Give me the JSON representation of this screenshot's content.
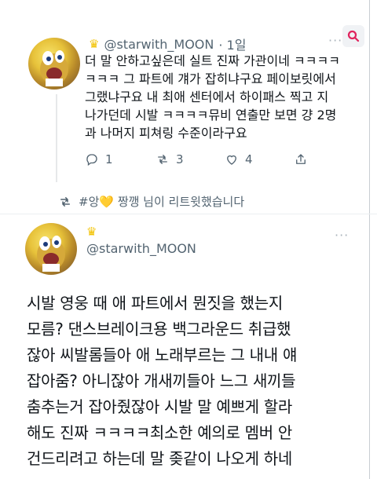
{
  "tweet1": {
    "handle": "@starwith_MOON",
    "time": "· 1일",
    "crown_icon": "crown",
    "text": "더 말 안하고싶은데 실트 진짜 가관이네 ㅋㅋㅋㅋ\nㅋㅋㅋ 그 파트에 걔가 잡히냐구요 페이보릿에서\n그랬냐구요  내 최애 센터에서 하이패스 찍고 지\n나가던데 시발 ㅋㅋㅋㅋ뮤비 연출만 보면 걍 2명\n과 나머지 피쳐링 수준이라구요",
    "reply_count": "1",
    "retweet_count": "3",
    "like_count": "4"
  },
  "retweet_banner": {
    "text": "#앙💛 짱깽 님이 리트윗했습니다"
  },
  "tweet2": {
    "handle": "@starwith_MOON",
    "crown_icon": "crown",
    "text": "시발 영웅 때 애 파트에서 뭔짓을 했는지\n모름? 댄스브레이크용 백그라운드 취급했\n잖아 씨발롬들아 애 노래부르는 그 내내 얘\n잡아줌? 아니잖아 개새끼들아 느그 새끼들\n춤추는거 잡아줬잖아 시발 말 예쁘게 할라\n해도 진짜 ㅋㅋㅋㅋ최소한 예의로 멤버 안\n건드리려고 하는데 말 좆같이 나오게 하네"
  },
  "colors": {
    "text": "#0f1419",
    "muted": "#536471",
    "search_accent": "#e0245e"
  }
}
